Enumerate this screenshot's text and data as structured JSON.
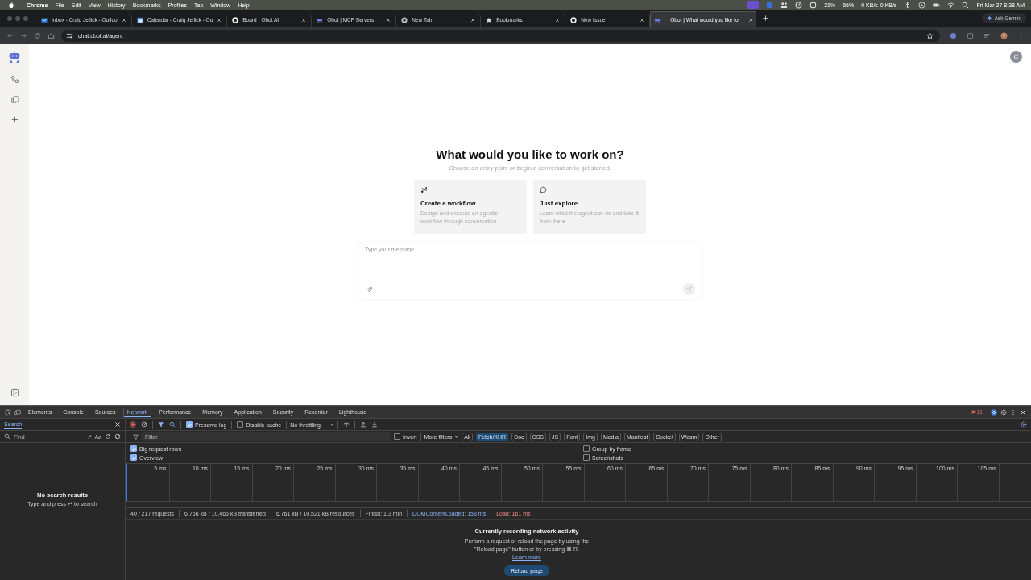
{
  "menu_bar": {
    "app": "Chrome",
    "menus": [
      "File",
      "Edit",
      "View",
      "History",
      "Bookmarks",
      "Profiles",
      "Tab",
      "Window",
      "Help"
    ],
    "cpu": "21%",
    "memory": "66%",
    "network_up": "0 KB/s",
    "network_down": "0 KB/s",
    "clock": "Fri Mar 27  8:38 AM"
  },
  "tabs": [
    {
      "title": "Inbox - Craig Jellick - Outloo",
      "kind": "mail",
      "selected": false
    },
    {
      "title": "Calendar - Craig Jellick - Ou",
      "kind": "calendar",
      "selected": false
    },
    {
      "title": "Board · Obot AI",
      "kind": "github",
      "selected": false
    },
    {
      "title": "Obot | MCP Servers",
      "kind": "obot",
      "selected": false
    },
    {
      "title": "New Tab",
      "kind": "chrome",
      "selected": false
    },
    {
      "title": "Bookmarks",
      "kind": "star",
      "selected": false
    },
    {
      "title": "New Issue",
      "kind": "github",
      "selected": false
    },
    {
      "title": "Obot | What would you like to",
      "kind": "obot",
      "selected": true
    }
  ],
  "ask_gemini": "Ask Gemini",
  "address": "chat.obot.ai/agent",
  "page": {
    "avatar": "C",
    "title": "What would you like to work on?",
    "subtitle": "Choose an entry point or begin a conversation to get started.",
    "cards": [
      {
        "kind": "workflow",
        "title": "Create a workflow",
        "text": "Design and execute an agentic workflow through conversation"
      },
      {
        "kind": "chat",
        "title": "Just explore",
        "text": "Learn what the agent can do and take it from there"
      }
    ],
    "message_placeholder": "Type your message..."
  },
  "devtools": {
    "panels": [
      {
        "label": "Elements",
        "selected": false
      },
      {
        "label": "Console",
        "selected": false
      },
      {
        "label": "Sources",
        "selected": false
      },
      {
        "label": "Network",
        "selected": true
      },
      {
        "label": "Performance",
        "selected": false
      },
      {
        "label": "Memory",
        "selected": false
      },
      {
        "label": "Application",
        "selected": false
      },
      {
        "label": "Security",
        "selected": false
      },
      {
        "label": "Recorder",
        "selected": false
      },
      {
        "label": "Lighthouse",
        "selected": false
      }
    ],
    "issues": "11",
    "search": {
      "tab": "Search",
      "placeholder": "Find",
      "regex_label": ".*",
      "case_label": "Aa",
      "empty_title": "No search results",
      "empty_hint": "Type and press ↵ to search"
    },
    "toolbar": {
      "preserve_log": {
        "label": "Preserve log",
        "checked": true
      },
      "disable_cache": {
        "label": "Disable cache",
        "checked": false
      },
      "throttling": "No throttling"
    },
    "filter": {
      "placeholder": "Filter",
      "invert": {
        "label": "Invert",
        "checked": false
      },
      "more_filters": "More filters",
      "types": [
        {
          "label": "All",
          "selected": false
        },
        {
          "label": "Fetch/XHR",
          "selected": true
        },
        {
          "label": "Doc",
          "selected": false
        },
        {
          "label": "CSS",
          "selected": false
        },
        {
          "label": "JS",
          "selected": false
        },
        {
          "label": "Font",
          "selected": false
        },
        {
          "label": "Img",
          "selected": false
        },
        {
          "label": "Media",
          "selected": false
        },
        {
          "label": "Manifest",
          "selected": false
        },
        {
          "label": "Socket",
          "selected": false
        },
        {
          "label": "Wasm",
          "selected": false
        },
        {
          "label": "Other",
          "selected": false
        }
      ]
    },
    "options": [
      {
        "label": "Big request rows",
        "checked": true
      },
      {
        "label": "Group by frame",
        "checked": false
      },
      {
        "label": "Overview",
        "checked": true
      },
      {
        "label": "Screenshots",
        "checked": false
      }
    ],
    "timeline_ticks": [
      "5 ms",
      "10 ms",
      "15 ms",
      "20 ms",
      "25 ms",
      "30 ms",
      "35 ms",
      "40 ms",
      "45 ms",
      "50 ms",
      "55 ms",
      "60 ms",
      "65 ms",
      "70 ms",
      "75 ms",
      "80 ms",
      "85 ms",
      "90 ms",
      "95 ms",
      "100 ms",
      "105 ms"
    ],
    "summary": [
      {
        "text": "40 / 217 requests",
        "kind": "plain"
      },
      {
        "text": "6,766 kB / 10,466 kB transferred",
        "kind": "plain"
      },
      {
        "text": "6,761 kB / 10,521 kB resources",
        "kind": "plain"
      },
      {
        "text": "Finish: 1.3 min",
        "kind": "plain"
      },
      {
        "text": "DOMContentLoaded: 158 ms",
        "kind": "dom"
      },
      {
        "text": "Load: 161 ms",
        "kind": "load"
      }
    ],
    "empty": {
      "title": "Currently recording network activity",
      "text": "Perform a request or reload the page by using the \"Reload page\" button or by pressing ⌘ R.",
      "link": "Learn more",
      "button": "Reload page"
    }
  }
}
